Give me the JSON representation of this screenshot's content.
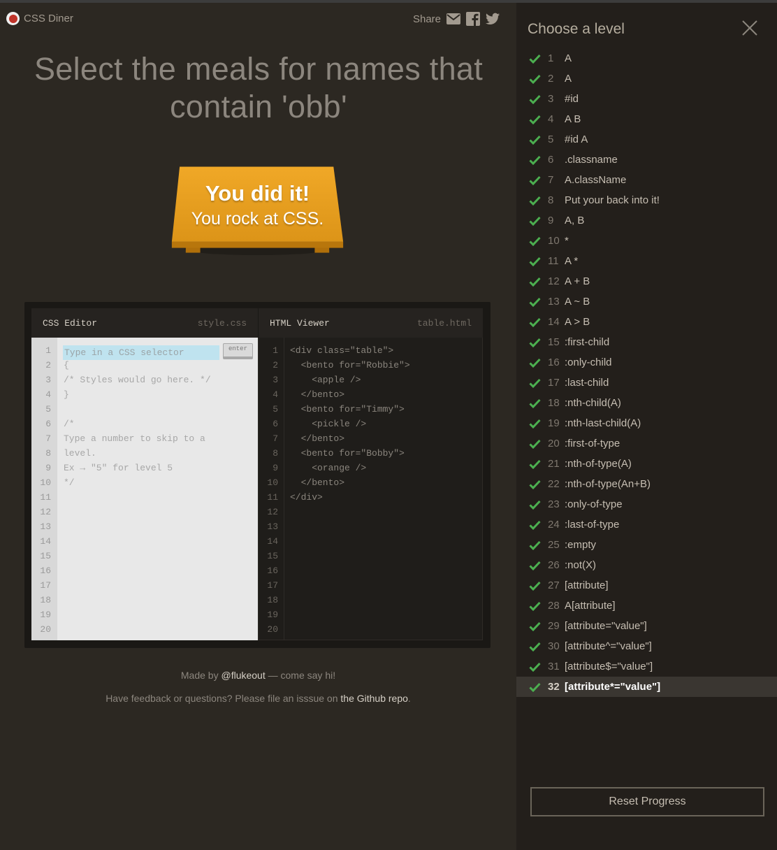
{
  "header": {
    "app_name": "CSS Diner",
    "share_label": "Share",
    "share_icons": [
      "mail-icon",
      "facebook-icon",
      "twitter-icon"
    ]
  },
  "instruction": "Select the meals for names that contain 'obb'",
  "table_message": {
    "line1": "You did it!",
    "line2": "You rock at CSS."
  },
  "editor": {
    "css_title": "CSS Editor",
    "css_file": "style.css",
    "html_title": "HTML Viewer",
    "html_file": "table.html",
    "input_placeholder": "Type in a CSS selector",
    "enter_label": "enter",
    "line_numbers": [
      "1",
      "2",
      "3",
      "4",
      "5",
      "6",
      "7",
      "8",
      "9",
      "10",
      "11",
      "12",
      "13",
      "14",
      "15",
      "16",
      "17",
      "18",
      "19",
      "20"
    ],
    "css_lines": [
      "{",
      "/* Styles would go here. */",
      "}",
      "",
      "/*",
      "Type a number to skip to a",
      "level.",
      "Ex → \"5\" for level 5",
      "*/"
    ],
    "html_lines": [
      "<div class=\"table\">",
      "  <bento for=\"Robbie\">",
      "    <apple />",
      "  </bento>",
      "  <bento for=\"Timmy\">",
      "    <pickle />",
      "  </bento>",
      "  <bento for=\"Bobby\">",
      "    <orange />",
      "  </bento>",
      "</div>"
    ]
  },
  "footer": {
    "made_by_prefix": "Made by ",
    "made_by_link": "@flukeout",
    "made_by_suffix": " — come say hi!",
    "feedback_prefix": "Have feedback or questions? Please file an isssue on ",
    "feedback_link": "the Github repo",
    "feedback_suffix": "."
  },
  "sidebar": {
    "title": "Choose a level",
    "current_level": "32",
    "reset_label": "Reset Progress",
    "levels": [
      {
        "num": "1",
        "name": "A"
      },
      {
        "num": "2",
        "name": "A"
      },
      {
        "num": "3",
        "name": "#id"
      },
      {
        "num": "4",
        "name": "A  B"
      },
      {
        "num": "5",
        "name": "#id  A"
      },
      {
        "num": "6",
        "name": ".classname"
      },
      {
        "num": "7",
        "name": "A.className"
      },
      {
        "num": "8",
        "name": "Put your back into it!"
      },
      {
        "num": "9",
        "name": "A, B"
      },
      {
        "num": "10",
        "name": "*"
      },
      {
        "num": "11",
        "name": "A  *"
      },
      {
        "num": "12",
        "name": "A + B"
      },
      {
        "num": "13",
        "name": "A ~ B"
      },
      {
        "num": "14",
        "name": "A > B"
      },
      {
        "num": "15",
        "name": ":first-child"
      },
      {
        "num": "16",
        "name": ":only-child"
      },
      {
        "num": "17",
        "name": ":last-child"
      },
      {
        "num": "18",
        "name": ":nth-child(A)"
      },
      {
        "num": "19",
        "name": ":nth-last-child(A)"
      },
      {
        "num": "20",
        "name": ":first-of-type"
      },
      {
        "num": "21",
        "name": ":nth-of-type(A)"
      },
      {
        "num": "22",
        "name": ":nth-of-type(An+B)"
      },
      {
        "num": "23",
        "name": ":only-of-type"
      },
      {
        "num": "24",
        "name": ":last-of-type"
      },
      {
        "num": "25",
        "name": ":empty"
      },
      {
        "num": "26",
        "name": ":not(X)"
      },
      {
        "num": "27",
        "name": "[attribute]"
      },
      {
        "num": "28",
        "name": "A[attribute]"
      },
      {
        "num": "29",
        "name": "[attribute=\"value\"]"
      },
      {
        "num": "30",
        "name": "[attribute^=\"value\"]"
      },
      {
        "num": "31",
        "name": "[attribute$=\"value\"]"
      },
      {
        "num": "32",
        "name": "[attribute*=\"value\"]"
      }
    ]
  },
  "colors": {
    "background": "#2c2822",
    "sidebar_bg": "#231f1b",
    "check_green": "#4caf50",
    "table_orange": "#e49a1f",
    "input_highlight": "#bfe3ef"
  }
}
